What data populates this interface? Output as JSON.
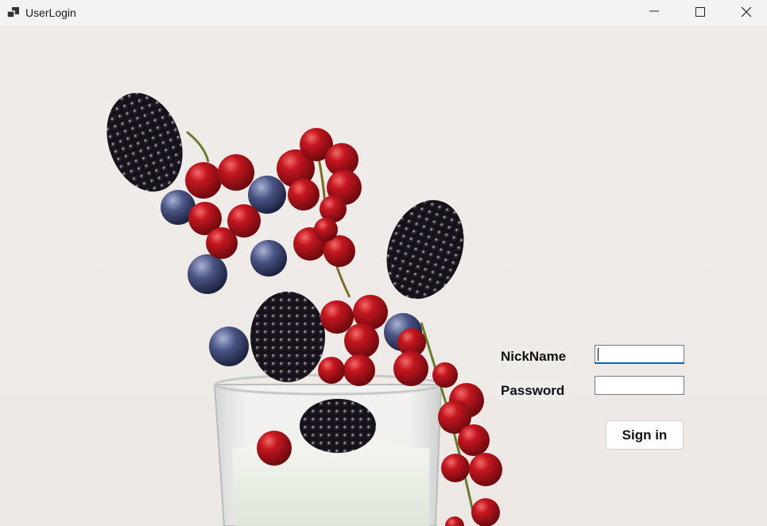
{
  "window": {
    "title": "UserLogin",
    "icon": "app-window-icon",
    "controls": [
      "minimize-icon",
      "maximize-icon",
      "close-icon"
    ]
  },
  "form": {
    "nickname_label": "NickName",
    "nickname_value": "",
    "password_label": "Password",
    "password_value": "",
    "signin_label": "Sign in"
  },
  "background": {
    "description_icon": "berries-photo",
    "accent_red": "#b5121b",
    "accent_dark": "#1c1a1f"
  }
}
